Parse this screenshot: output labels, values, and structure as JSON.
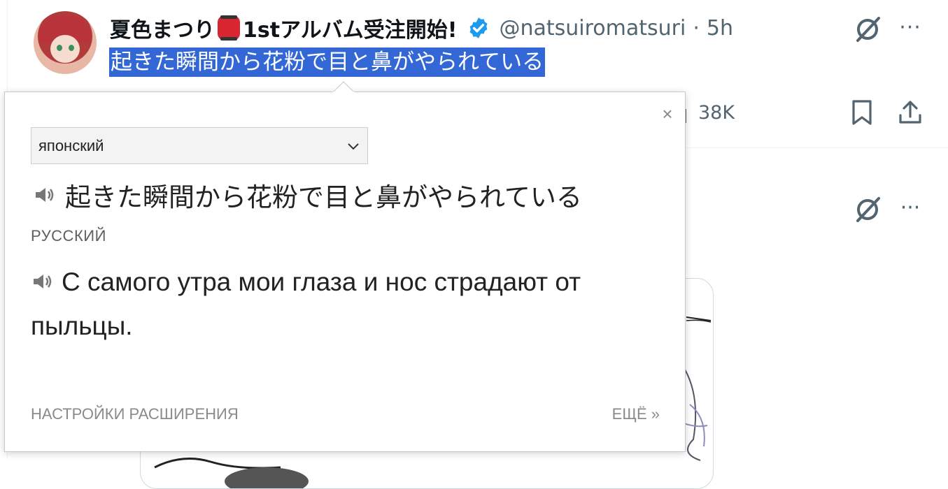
{
  "tweet": {
    "display_name_part1": "夏色まつり",
    "display_name_part2": "1stアルバム受注開始!",
    "handle": "@natsuiromatsuri",
    "separator": "·",
    "time": "5h",
    "text": "起きた瞬間から花粉で目と鼻がやられている",
    "views": "38K",
    "more_label": "···"
  },
  "popup": {
    "close_label": "×",
    "source_language": "японский",
    "source_text": "起きた瞬間から花粉で目と鼻がやられている",
    "target_language": "РУССКИЙ",
    "translation": "С самого утра мои глаза и нос страдают от пыльцы.",
    "settings_link": "НАСТРОЙКИ РАСШИРЕНИЯ",
    "more_link": "ЕЩЁ »"
  },
  "colors": {
    "selection_bg": "#3367d6",
    "verified": "#1d9bf0",
    "muted": "#536471"
  }
}
